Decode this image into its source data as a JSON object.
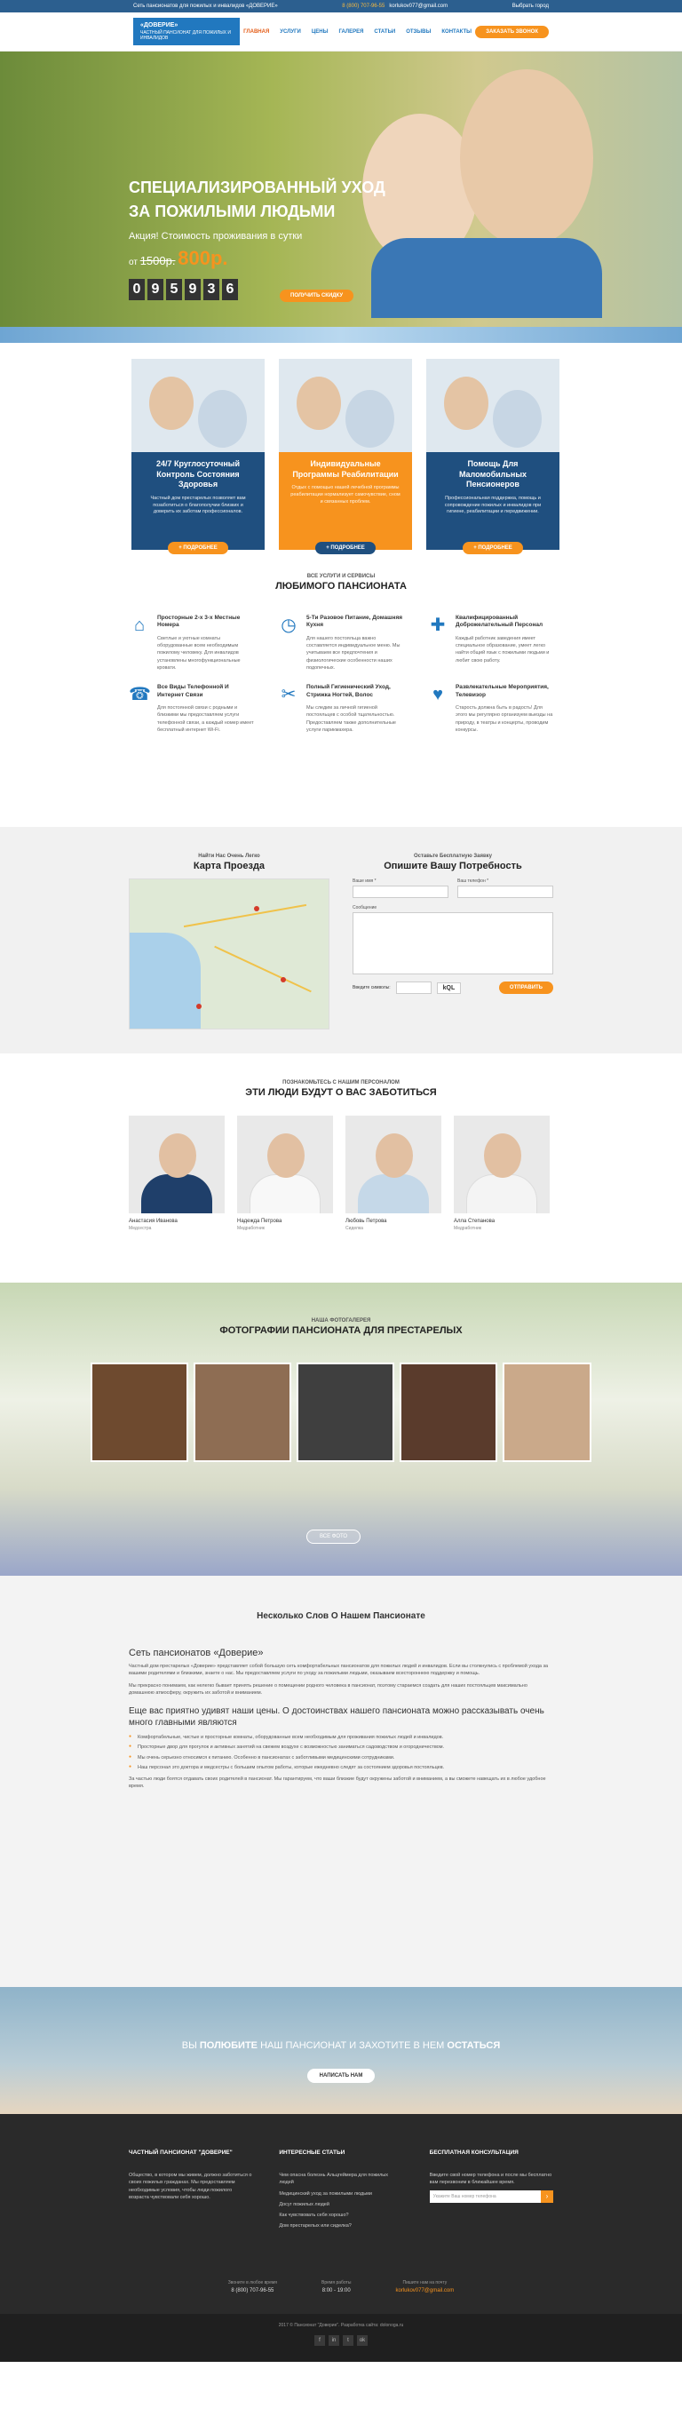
{
  "topbar": {
    "left": "Сеть пансионатов для пожилых и инвалидов «ДОВЕРИЕ»",
    "phone": "8 (800) 707-96-55",
    "email": "korlukov077@gmail.com",
    "lang": "Выбрать город"
  },
  "header": {
    "logo_title": "«ДОВЕРИЕ»",
    "logo_sub": "ЧАСТНЫЙ ПАНСИОНАТ ДЛЯ ПОЖИЛЫХ И ИНВАЛИДОВ",
    "nav": [
      "ГЛАВНАЯ",
      "УСЛУГИ",
      "ЦЕНЫ",
      "ГАЛЕРЕЯ",
      "СТАТЬИ",
      "ОТЗЫВЫ",
      "КОНТАКТЫ"
    ],
    "call_button": "ЗАКАЗАТЬ ЗВОНОК"
  },
  "hero": {
    "title_line1": "СПЕЦИАЛИЗИРОВАННЫЙ УХОД",
    "title_line2": "ЗА ПОЖИЛЫМИ ЛЮДЬМИ",
    "promo": "Акция! Стоимость проживания в сутки",
    "price_from": "от",
    "old_price": "1500р.",
    "new_price": "800р.",
    "timer": [
      "0",
      "9",
      "5",
      "9",
      "3",
      "6"
    ],
    "cta": "ПОЛУЧИТЬ СКИДКУ"
  },
  "cards": [
    {
      "title": "24/7 Круглосуточный Контроль Состояния Здоровья",
      "text": "Частный дом престарелых позволяет вам позаботиться о благополучии близких и доверить их заботам профессионалов.",
      "button": "+ ПОДРОБНЕЕ"
    },
    {
      "title": "Индивидуальные Программы Реабилитации",
      "text": "Отдых с помощью нашей лечебной программы реабилитации нормализует самочувствие, сном и связанных проблем.",
      "button": "+ ПОДРОБНЕЕ"
    },
    {
      "title": "Помощь Для Маломобильных Пенсионеров",
      "text": "Профессиональная поддержка, помощь и сопровождение пожилых и инвалидов при гигиене, реабилитации и передвижении.",
      "button": "+ ПОДРОБНЕЕ"
    }
  ],
  "services": {
    "sub": "ВСЕ УСЛУГИ И СЕРВИСЫ",
    "title": "ЛЮБИМОГО ПАНСИОНАТА",
    "items": [
      {
        "icon": "house-icon",
        "title": "Просторные 2-х 3-х Местные Номера",
        "text": "Светлые и уютные комнаты оборудованные всем необходимым пожилому человеку. Для инвалидов установлены многофункциональные кровати."
      },
      {
        "icon": "clock-icon",
        "title": "5-Ти Разовое Питание, Домашняя Кухня",
        "text": "Для нашего постояльца важно составляется индивидуальное меню. Мы учитываем все предпочтения и физиологические особенности наших подопечных."
      },
      {
        "icon": "nurse-icon",
        "title": "Квалифицированный Доброжелательный Персонал",
        "text": "Каждый работник заведения имеет специальное образование, умеет легко найти общий язык с пожилыми людьми и любит свою работу."
      },
      {
        "icon": "phone-icon",
        "title": "Все Виды Телефонной И Интернет Связи",
        "text": "Для постоянной связи с родными и близкими мы предоставляем услуги телефонной связи, а каждый номер имеет бесплатный интернет Wi-Fi."
      },
      {
        "icon": "scissors-icon",
        "title": "Полный Гигиенический Уход, Стрижка Ногтей, Волос",
        "text": "Мы следим за личной гигиеной постояльцев с особой тщательностью. Предоставляем также дополнительные услуги парикмахера."
      },
      {
        "icon": "heart-icon",
        "title": "Развлекательные Мероприятия, Телевизор",
        "text": "Старость должна быть в радость! Для этого мы регулярно организуем выезды на природу, в театры и концерты, проводим конкурсы."
      }
    ]
  },
  "map": {
    "sub": "Найти Нас Очень Легко",
    "title": "Карта Проезда"
  },
  "form": {
    "sub": "Оставьте Бесплатную Заявку",
    "title": "Опишите Вашу Потребность",
    "name_label": "Ваше имя *",
    "phone_label": "Ваш телефон *",
    "message_label": "Сообщение",
    "captcha_label": "Введите символы:",
    "captcha_code": "kQL",
    "submit": "ОТПРАВИТЬ"
  },
  "staff": {
    "sub": "ПОЗНАКОМЬТЕСЬ С НАШИМ ПЕРСОНАЛОМ",
    "title": "ЭТИ ЛЮДИ БУДУТ О ВАС ЗАБОТИТЬСЯ",
    "people": [
      {
        "name": "Анастасия Иванова",
        "role": "Медсестра",
        "color": "#1f3f6a"
      },
      {
        "name": "Надежда Петрова",
        "role": "Медработник",
        "color": "#f0f0f0"
      },
      {
        "name": "Любовь Петрова",
        "role": "Сиделка",
        "color": "#c5d8e8"
      },
      {
        "name": "Алла Степанова",
        "role": "Медработник",
        "color": "#f4f4f4"
      }
    ]
  },
  "gallery": {
    "sub": "НАША ФОТОГАЛЕРЕЯ",
    "title": "ФОТОГРАФИИ ПАНСИОНАТА ДЛЯ ПРЕСТАРЕЛЫХ",
    "all_button": "ВСЕ ФОТО",
    "colors": [
      "#6e4a2f",
      "#8e6d53",
      "#3f3f3f",
      "#5a3b2c",
      "#caa98a"
    ]
  },
  "about": {
    "title": "Несколько Слов О Нашем Пансионате",
    "h3": "Сеть пансионатов «Доверие»",
    "p1": "Частный дом престарелых «Доверие» представляет собой большую сеть комфортабельных пансионатов для пожилых людей и инвалидов. Если вы столкнулись с проблемой ухода за вашими родителями и близкими, знаете о нас. Мы предоставляем услуги по уходу за пожилыми людьми, оказываем всестороннюю поддержку и помощь.",
    "p2": "Мы прекрасно понимаем, как нелегко бывает принять решение о помещении родного человека в пансионат, поэтому стараемся создать для наших постояльцев максимально домашнюю атмосферу, окружить их заботой и вниманием.",
    "h4": "Еще вас приятно удивят наши цены. О достоинствах нашего пансионата можно рассказывать очень много главными являются",
    "bullets": [
      "Комфортабельные, чистые и просторные комнаты, оборудованные всем необходимым для проживания пожилых людей и инвалидов.",
      "Просторные двор для прогулок и активных занятий на свежем воздухе с возможностью заниматься садоводством и огородничеством.",
      "Мы очень серьезно относимся к питанию. Особенно в пансионатах с заботливыми медицинскими сотрудниками.",
      "Наш персонал это доктора и медсестры с большим опытом работы, которые ежедневно следят за состоянием здоровья постояльцев."
    ],
    "p3": "За частью люди боятся отдавать своих родителей в пансионат. Мы гарантируем, что ваши близкие будут окружены заботой и вниманием, а вы сможете навещать их в любое удобное время."
  },
  "love": {
    "pre": "ВЫ",
    "mid": "ПОЛЮБИТЕ",
    "post": "НАШ ПАНСИОНАТ И ЗАХОТИТЕ В НЕМ",
    "end": "ОСТАТЬСЯ",
    "button": "НАПИСАТЬ НАМ"
  },
  "footer": {
    "col1_title": "ЧАСТНЫЙ ПАНСИОНАТ \"ДОВЕРИЕ\"",
    "col1_text": "Общество, в котором мы живем, должно заботиться о своих пожилых гражданах. Мы предоставляем необходимые условия, чтобы люди пожилого возраста чувствовали себя хорошо.",
    "col2_title": "ИНТЕРЕСНЫЕ СТАТЬИ",
    "articles": [
      "Чем опасна болезнь Альцгеймера для пожилых людей",
      "Медицинский уход за пожилыми людьми",
      "Досуг пожилых людей",
      "Как чувствовать себя хорошо?",
      "Дом престарелых или сиделка?"
    ],
    "col3_title": "БЕСПЛАТНАЯ КОНСУЛЬТАЦИЯ",
    "col3_text": "Введите свой номер телефона и после мы бесплатно вам перезвоним в ближайшее время.",
    "input_placeholder": "Укажите Ваш номер телефона",
    "contacts": [
      {
        "label": "Звоните в любое время",
        "value": "8 (800) 707-96-55"
      },
      {
        "label": "Время работы",
        "value": "8:00 - 19:00"
      },
      {
        "label": "Пишите нам на почту",
        "value": "korlukov077@gmail.com"
      }
    ],
    "copyright": "2017 © Пансионат \"Доверие\". Разработка сайта: dolonoga.ru",
    "social": [
      "f",
      "in",
      "t",
      "ok"
    ]
  }
}
